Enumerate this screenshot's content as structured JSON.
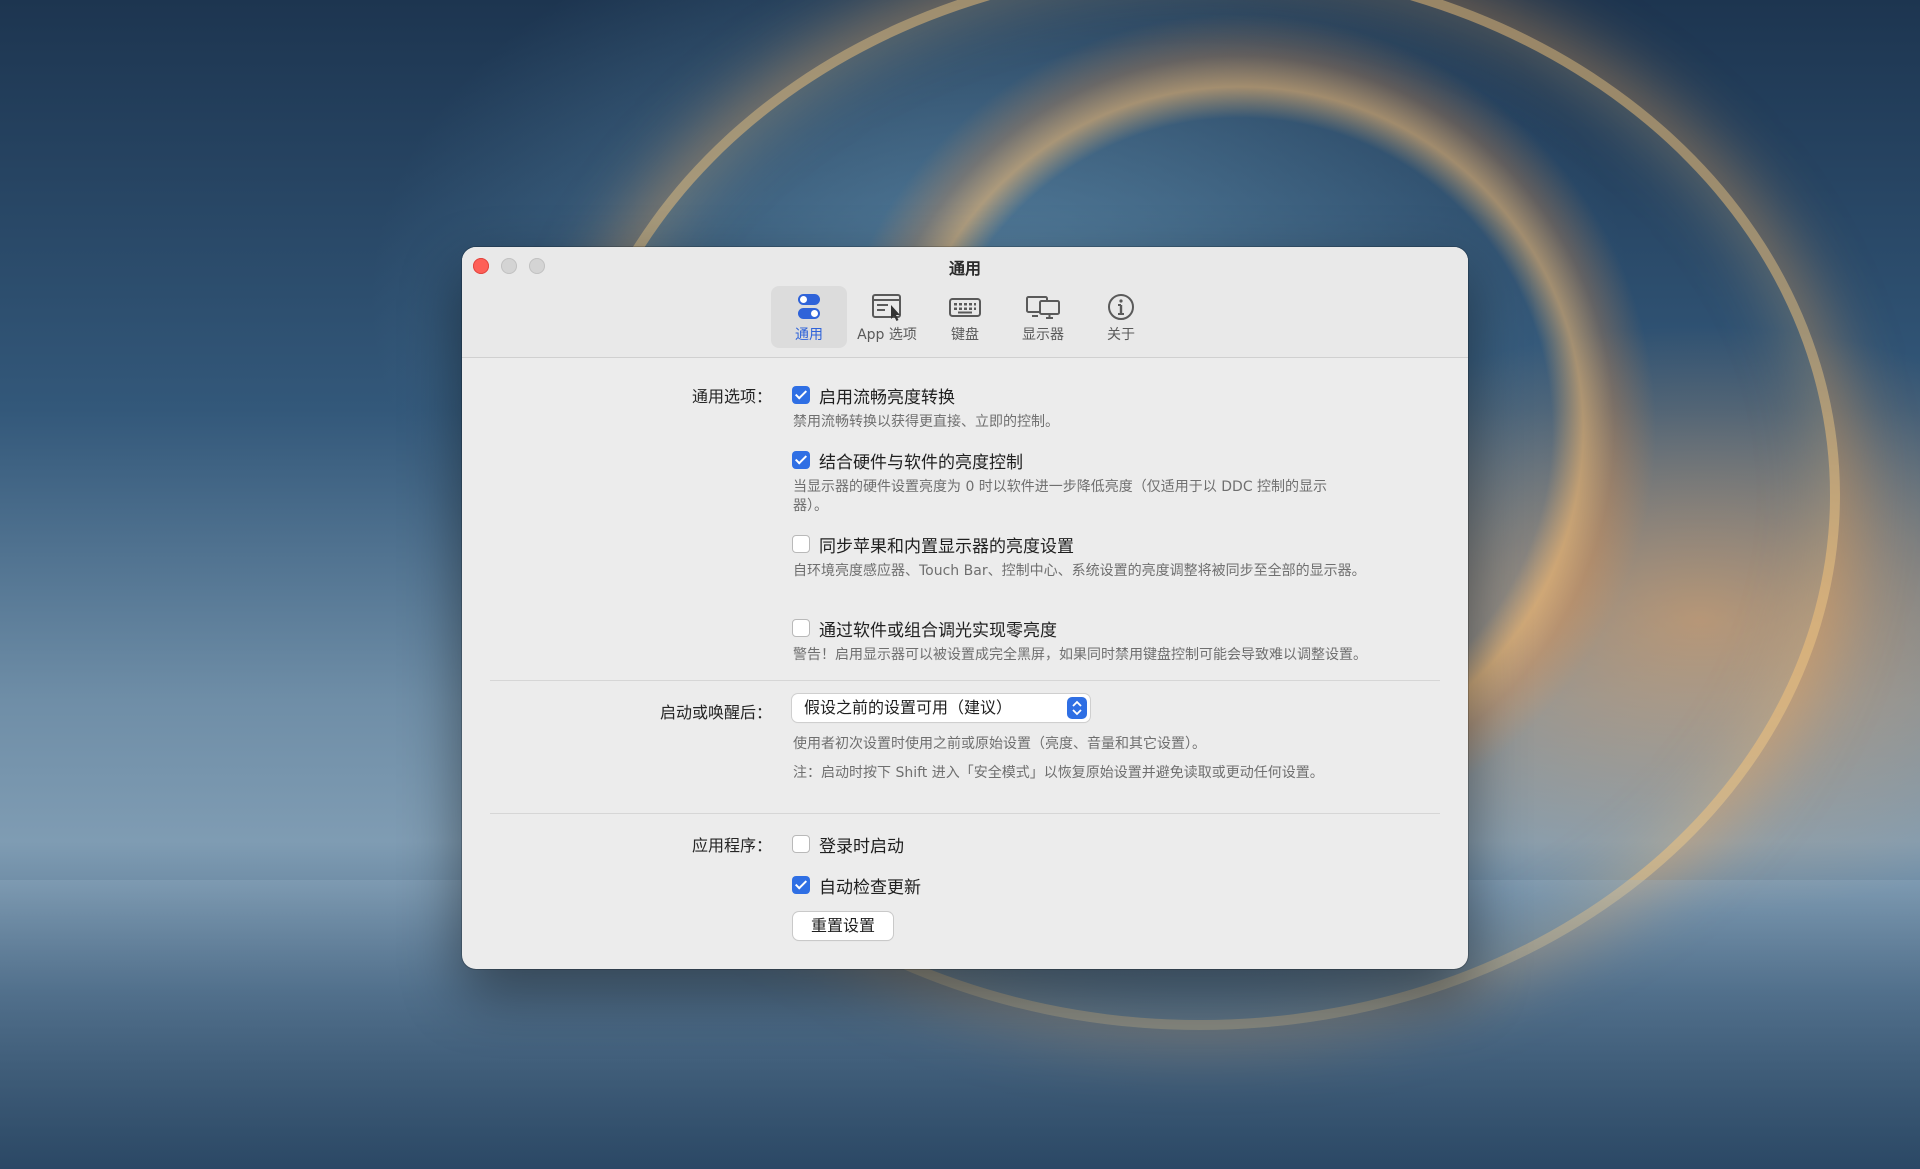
{
  "window": {
    "title": "通用",
    "tabs": [
      {
        "label": "通用",
        "icon": "toggle-switches-icon",
        "active": true
      },
      {
        "label": "App 选项",
        "icon": "app-window-cursor-icon",
        "active": false
      },
      {
        "label": "键盘",
        "icon": "keyboard-icon",
        "active": false
      },
      {
        "label": "显示器",
        "icon": "displays-icon",
        "active": false
      },
      {
        "label": "关于",
        "icon": "info-icon",
        "active": false
      }
    ]
  },
  "general": {
    "label": "通用选项：",
    "options": [
      {
        "label": "启用流畅亮度转换",
        "checked": true,
        "desc": "禁用流畅转换以获得更直接、立即的控制。"
      },
      {
        "label": "结合硬件与软件的亮度控制",
        "checked": true,
        "desc": "当显示器的硬件设置亮度为 0 时以软件进一步降低亮度（仅适用于以 DDC 控制的显示器）。"
      },
      {
        "label": "同步苹果和内置显示器的亮度设置",
        "checked": false,
        "desc": "自环境亮度感应器、Touch Bar、控制中心、系统设置的亮度调整将被同步至全部的显示器。"
      },
      {
        "label": "通过软件或组合调光实现零亮度",
        "checked": false,
        "desc": "警告！启用显示器可以被设置成完全黑屏，如果同时禁用键盘控制可能会导致难以调整设置。"
      }
    ]
  },
  "startup": {
    "label": "启动或唤醒后：",
    "selected": "假设之前的设置可用（建议）",
    "desc1": "使用者初次设置时使用之前或原始设置（亮度、音量和其它设置）。",
    "desc2": "注：启动时按下 Shift 进入「安全模式」以恢复原始设置并避免读取或更动任何设置。"
  },
  "app": {
    "label": "应用程序：",
    "options": [
      {
        "label": "登录时启动",
        "checked": false
      },
      {
        "label": "自动检查更新",
        "checked": true
      }
    ],
    "reset_label": "重置设置"
  },
  "colors": {
    "accent": "#2f6fe4",
    "close": "#fe5f57"
  }
}
